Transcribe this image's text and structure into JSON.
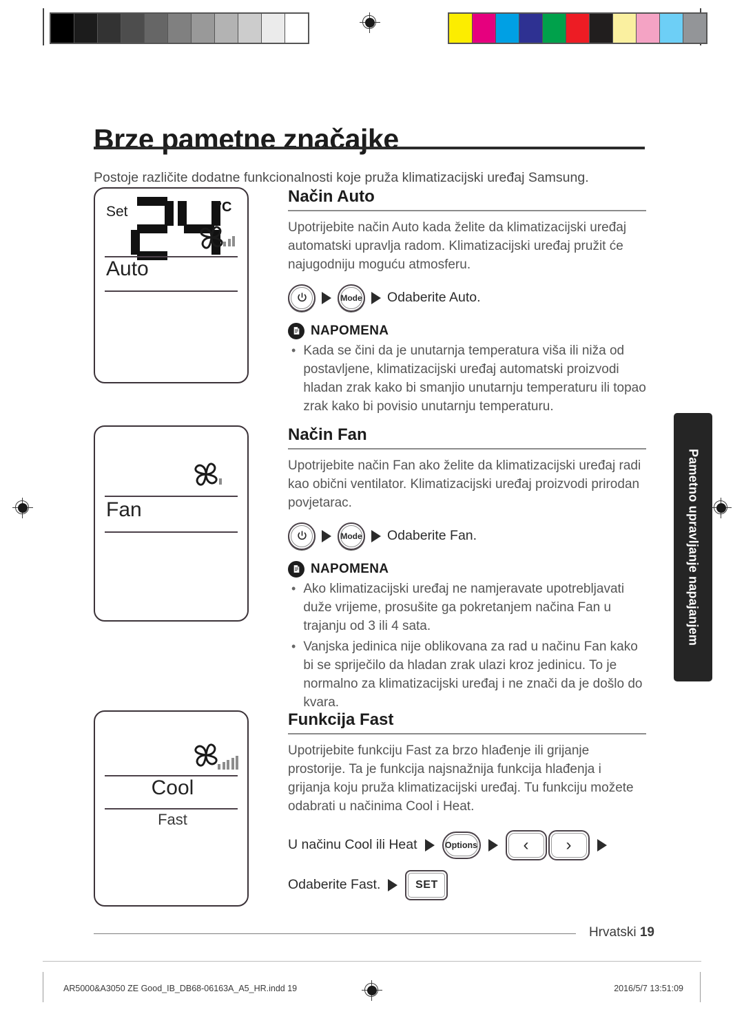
{
  "page": {
    "title": "Brze pametne značajke",
    "intro": "Postoje različite dodatne funkcionalnosti koje pruža klimatizacijski uređaj Samsung.",
    "side_tab": "Pametno upravljanje napajanjem",
    "footer_language": "Hrvatski",
    "footer_page_number": "19",
    "imprint_file": "AR5000&A3050 ZE Good_IB_DB68-06163A_A5_HR.indd   19",
    "imprint_timestamp": "2016/5/7   13:51:09"
  },
  "calibration": {
    "gray_swatches": [
      "#000000",
      "#1c1c1c",
      "#333333",
      "#4d4d4d",
      "#666666",
      "#808080",
      "#999999",
      "#b3b3b3",
      "#cccccc",
      "#ebebeb",
      "#ffffff"
    ],
    "color_swatches": [
      "#fced00",
      "#e6007e",
      "#00a0e4",
      "#2e3192",
      "#00a14b",
      "#ed1c24",
      "#211e1e",
      "#faf0a0",
      "#f4a3c4",
      "#6dcff6",
      "#939598"
    ]
  },
  "displays": [
    {
      "name": "auto-display",
      "set_label": "Set",
      "temperature": "24",
      "unit": "°C",
      "mode_label": "Auto",
      "sub_label": "",
      "fan_bars": 3,
      "fan_bar_heights": [
        7,
        11,
        15
      ]
    },
    {
      "name": "fan-display",
      "set_label": "",
      "temperature": "",
      "unit": "",
      "mode_label": "Fan",
      "sub_label": "",
      "fan_bars": 1,
      "fan_bar_heights": [
        9
      ]
    },
    {
      "name": "cool-fast-display",
      "set_label": "",
      "temperature": "",
      "unit": "",
      "mode_label": "Cool",
      "sub_label": "Fast",
      "fan_bars": 5,
      "fan_bar_heights": [
        8,
        11,
        14,
        17,
        20
      ]
    }
  ],
  "sections": [
    {
      "heading": "Način Auto",
      "body": "Upotrijebite način Auto kada želite da klimatizacijski uređaj automatski upravlja radom. Klimatizacijski uređaj pružit će najugodniju moguću atmosferu.",
      "steps": {
        "power_button": "power-icon",
        "mode_button": "Mode",
        "instruction": "Odaberite Auto."
      },
      "note_title": "NAPOMENA",
      "note_icon": "document-note-icon",
      "bullets": [
        "Kada se čini da je unutarnja temperatura viša ili niža od postavljene, klimatizacijski uređaj automatski proizvodi hladan zrak kako bi smanjio unutarnju temperaturu ili topao zrak kako bi povisio unutarnju temperaturu."
      ]
    },
    {
      "heading": "Način Fan",
      "body": "Upotrijebite način Fan ako želite da klimatizacijski uređaj radi kao obični ventilator. Klimatizacijski uređaj proizvodi prirodan povjetarac.",
      "steps": {
        "power_button": "power-icon",
        "mode_button": "Mode",
        "instruction": "Odaberite Fan."
      },
      "note_title": "NAPOMENA",
      "note_icon": "document-note-icon",
      "bullets": [
        "Ako klimatizacijski uređaj ne namjeravate upotrebljavati duže vrijeme, prosušite ga pokretanjem načina Fan u trajanju od 3 ili 4 sata.",
        "Vanjska jedinica nije oblikovana za rad u načinu Fan kako bi se spriječilo da hladan zrak ulazi kroz jedinicu. To je normalno za klimatizacijski uređaj i ne znači da je došlo do kvara."
      ]
    },
    {
      "heading": "Funkcija Fast",
      "body": "Upotrijebite funkciju Fast za brzo hlađenje ili grijanje prostorije. Ta je funkcija najsnažnija funkcija hlađenja i grijanja koju pruža klimatizacijski uređaj. Tu funkciju možete odabrati u načinima Cool i Heat.",
      "fast_steps": {
        "line1_text": "U načinu Cool ili Heat",
        "options_button": "Options",
        "left_arrow": "‹",
        "right_arrow": "›",
        "line2_text": "Odaberite Fast.",
        "set_button": "SET"
      }
    }
  ]
}
